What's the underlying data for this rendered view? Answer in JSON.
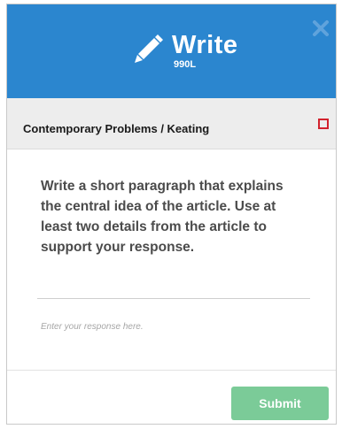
{
  "header": {
    "title": "Write",
    "level": "990L",
    "icon": "pencil-icon",
    "close_icon": "close-icon",
    "background_color": "#2b86cf"
  },
  "subheader": {
    "course": "Contemporary Problems / Keating",
    "indicator_color": "#d2222d"
  },
  "prompt": {
    "text": "Write a short paragraph that explains the central idea of the article. Use at least two details from the article to support your response."
  },
  "response": {
    "placeholder": "Enter your response here.",
    "value": ""
  },
  "footer": {
    "submit_label": "Submit",
    "submit_color": "#7bcb98"
  }
}
